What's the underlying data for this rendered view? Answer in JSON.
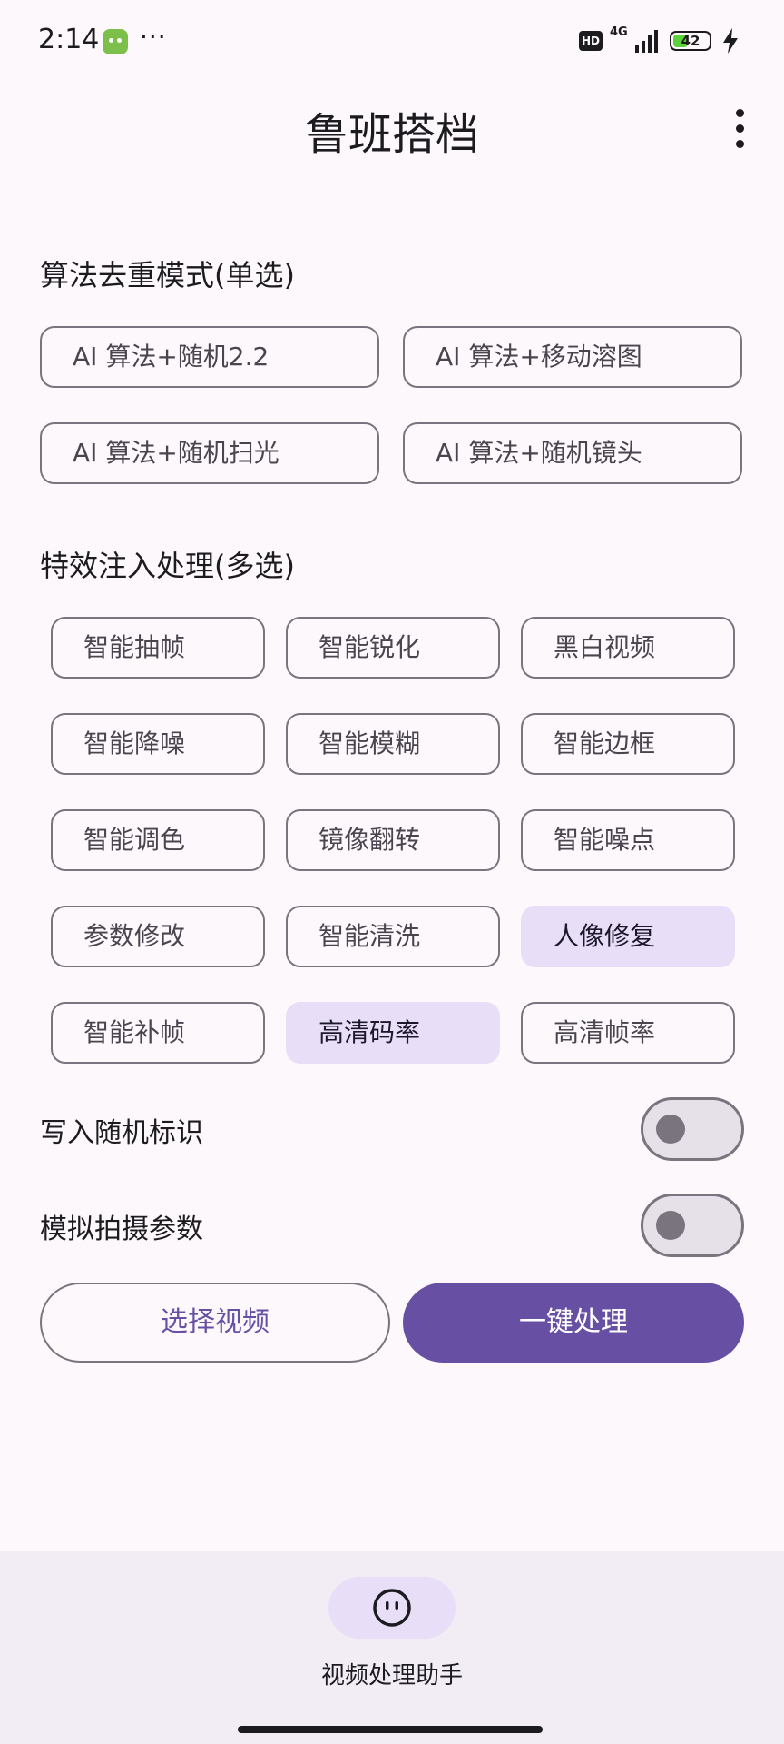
{
  "status_bar": {
    "time": "2:14",
    "more": "···",
    "hd": "HD",
    "network": "4G",
    "battery": "42",
    "battery_level": 0.42,
    "battery_color": "#5bd13a"
  },
  "app_bar": {
    "title": "鲁班搭档"
  },
  "mode_section": {
    "title": "算法去重模式(单选)",
    "options": [
      "AI 算法+随机2.2",
      "AI 算法+移动溶图",
      "AI 算法+随机扫光",
      "AI 算法+随机镜头"
    ]
  },
  "effects_section": {
    "title": "特效注入处理(多选)",
    "chips": [
      {
        "label": "智能抽帧",
        "selected": false
      },
      {
        "label": "智能锐化",
        "selected": false
      },
      {
        "label": "黑白视频",
        "selected": false
      },
      {
        "label": "智能降噪",
        "selected": false
      },
      {
        "label": "智能模糊",
        "selected": false
      },
      {
        "label": "智能边框",
        "selected": false
      },
      {
        "label": "智能调色",
        "selected": false
      },
      {
        "label": "镜像翻转",
        "selected": false
      },
      {
        "label": "智能噪点",
        "selected": false
      },
      {
        "label": "参数修改",
        "selected": false
      },
      {
        "label": "智能清洗",
        "selected": false
      },
      {
        "label": "人像修复",
        "selected": true
      },
      {
        "label": "智能补帧",
        "selected": false
      },
      {
        "label": "高清码率",
        "selected": true
      },
      {
        "label": "高清帧率",
        "selected": false
      }
    ]
  },
  "toggles": [
    {
      "label": "写入随机标识",
      "on": false
    },
    {
      "label": "模拟拍摄参数",
      "on": false
    }
  ],
  "actions": {
    "select_video": "选择视频",
    "process": "一键处理"
  },
  "bottom_nav": {
    "label": "视频处理助手",
    "icon": "face-icon"
  },
  "colors": {
    "primary": "#6750a4",
    "secondary_container": "#e8def8",
    "outline": "#79747e",
    "background": "#fdf8fc"
  }
}
